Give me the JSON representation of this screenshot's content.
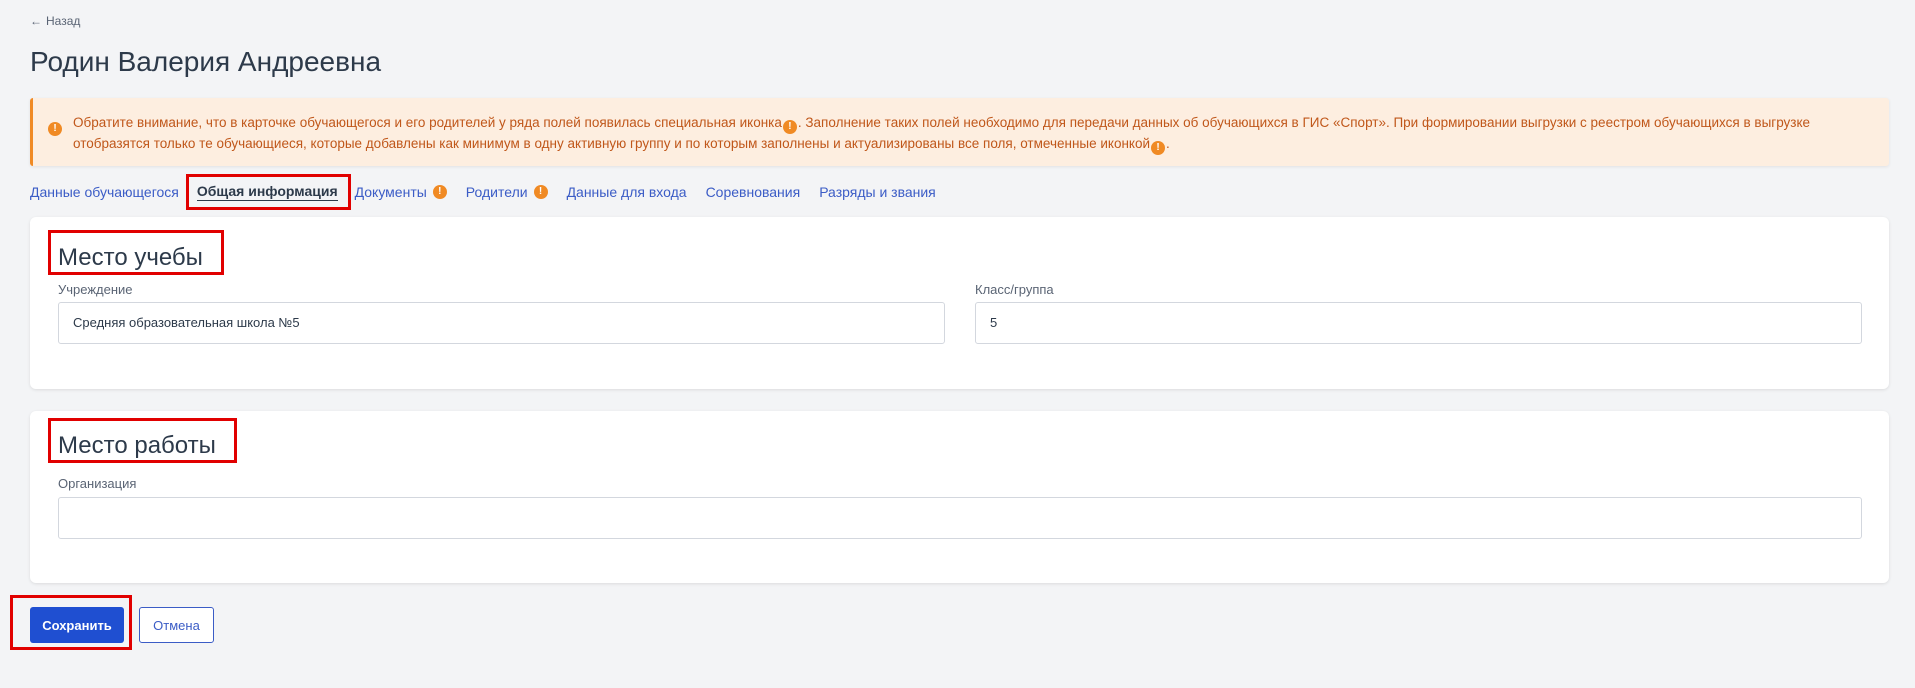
{
  "back_label": "Назад",
  "page_title": "Родин Валерия Андреевна",
  "alert": {
    "part1": "Обратите внимание, что в карточке обучающегося и его родителей у ряда полей появилась специальная иконка",
    "part2": ". Заполнение таких полей необходимо для передачи данных об обучающихся в ГИС «Спорт». При формировании выгрузки с реестром обучающихся в выгрузке отобразятся только те обучающиеся, которые добавлены как минимум в одну активную группу и по которым заполнены и актуализированы все поля, отмеченные иконкой",
    "part3": "."
  },
  "tabs": [
    {
      "label": "Данные обучающегося"
    },
    {
      "label": "Общая информация",
      "active": true
    },
    {
      "label": "Документы",
      "warning": true
    },
    {
      "label": "Родители",
      "warning": true
    },
    {
      "label": "Данные для входа"
    },
    {
      "label": "Соревнования"
    },
    {
      "label": "Разряды и звания"
    }
  ],
  "study": {
    "title": "Место учебы",
    "institution_label": "Учреждение",
    "institution_value": "Средняя образовательная школа №5",
    "class_label": "Класс/группа",
    "class_value": "5"
  },
  "work": {
    "title": "Место работы",
    "org_label": "Организация",
    "org_value": ""
  },
  "buttons": {
    "save": "Сохранить",
    "cancel": "Отмена"
  },
  "colors": {
    "primary": "#1f4fd1",
    "link": "#3b5cc6",
    "warning": "#f08a24",
    "alert_bg": "#fdeee0",
    "highlight": "#e10000"
  }
}
